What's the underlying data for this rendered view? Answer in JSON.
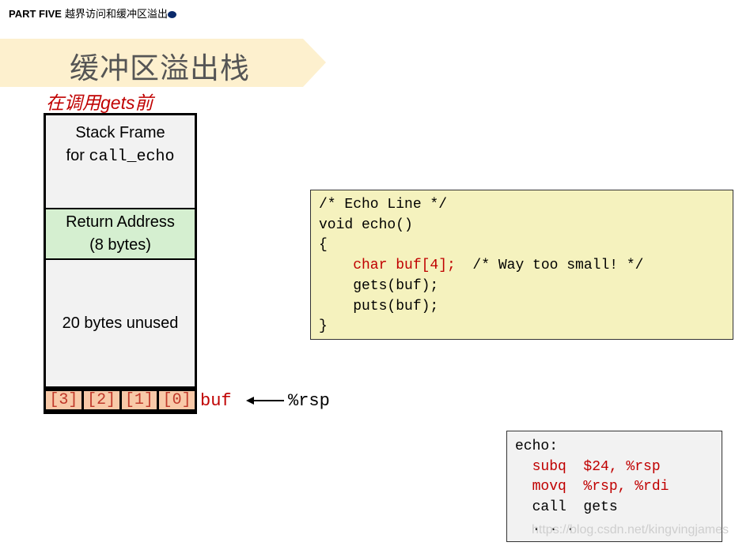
{
  "header": {
    "part": "PART FIVE",
    "section": "越界访问和缓冲区溢出"
  },
  "title": "缓冲区溢出栈",
  "subtitle": "在调用gets前",
  "stack": {
    "frame_line1": "Stack Frame",
    "frame_line2_prefix": "for ",
    "frame_line2_code": "call_echo",
    "return_line1": "Return Address",
    "return_line2": "(8 bytes)",
    "unused": "20 bytes unused",
    "buf_cells": [
      "[3]",
      "[2]",
      "[1]",
      "[0]"
    ]
  },
  "buf_label": "buf",
  "rsp_label": "%rsp",
  "c_code": {
    "l1": "/* Echo Line */",
    "l2": "void echo()",
    "l3": "{",
    "l4_red": "    char buf[4];",
    "l4_rest": "  /* Way too small! */",
    "l5": "    gets(buf);",
    "l6": "    puts(buf);",
    "l7": "}"
  },
  "asm": {
    "l1": "echo:",
    "l2": "  subq  $24, %rsp",
    "l3": "  movq  %rsp, %rdi",
    "l4": "  call  gets",
    "l5": "  . . ."
  },
  "watermark": "https://blog.csdn.net/kingvingjames"
}
